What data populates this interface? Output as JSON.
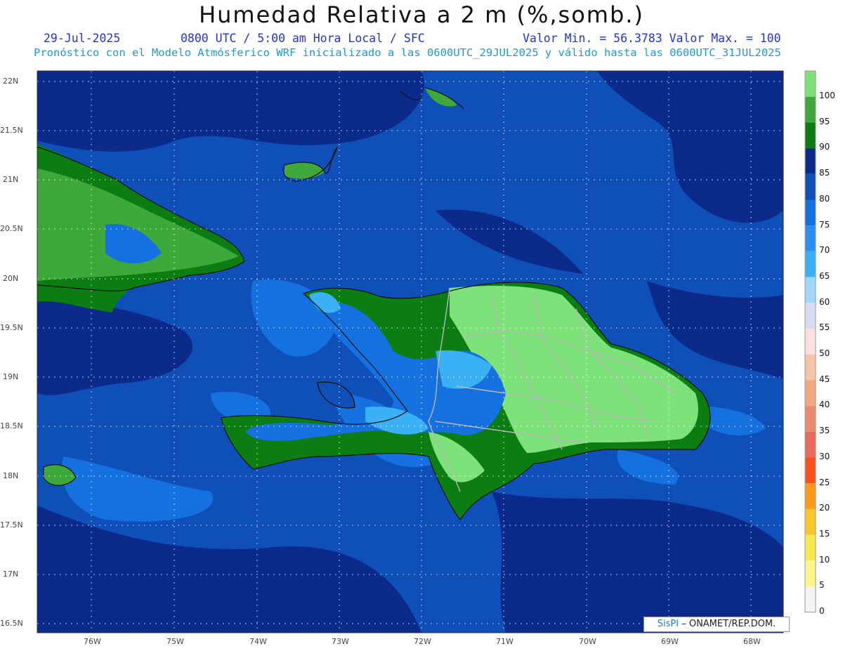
{
  "header": {
    "title": "Humedad Relativa a 2 m (%,somb.)",
    "date": "29-Jul-2025",
    "time": "0800 UTC / 5:00 am Hora Local / SFC",
    "minmax": "Valor Min. = 56.3783  Valor Max. = 100",
    "model_line": "Pronóstico con el Modelo Atmósferico WRF inicializado a las 0600UTC_29JUL2025 y válido hasta las  0600UTC_31JUL2025"
  },
  "axes": {
    "lat_labels": [
      "22N",
      "21.5N",
      "21N",
      "20.5N",
      "20N",
      "19.5N",
      "19N",
      "18.5N",
      "18N",
      "17.5N",
      "17N",
      "16.5N"
    ],
    "lon_labels": [
      "76W",
      "75W",
      "74W",
      "73W",
      "72W",
      "71W",
      "70W",
      "69W",
      "68W"
    ]
  },
  "colorbar": {
    "levels": [
      "100",
      "95",
      "90",
      "85",
      "80",
      "75",
      "70",
      "65",
      "60",
      "55",
      "50",
      "45",
      "40",
      "35",
      "30",
      "25",
      "20",
      "15",
      "10",
      "5",
      "0"
    ],
    "colors": [
      "#7ee27a",
      "#3ea83a",
      "#0b7d12",
      "#0c2a8a",
      "#0f4fb8",
      "#1570e0",
      "#2a8ff0",
      "#3ab0f5",
      "#a0d6f8",
      "#d8dcf2",
      "#fbe0de",
      "#f7c3a6",
      "#f0a880",
      "#ec8a70",
      "#e86a58",
      "#fb4f1c",
      "#fa9a18",
      "#f8c82a",
      "#f8e850",
      "#fbf68a",
      "#f4f4f4"
    ]
  },
  "credit": {
    "brand": "SisPI",
    "org": "– ONAMET/REP.DOM."
  }
}
